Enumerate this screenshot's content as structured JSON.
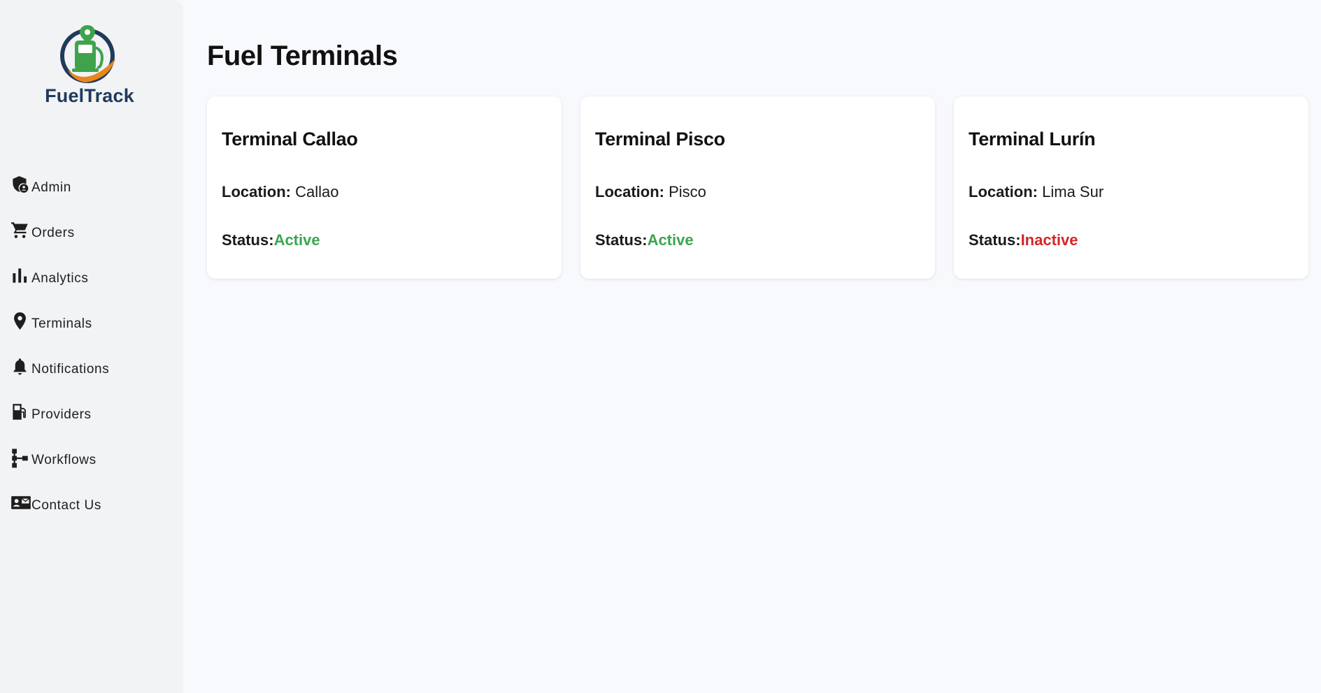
{
  "app": {
    "brand_name": "FuelTrack",
    "accent_colors": {
      "brand_navy": "#1f3a5c",
      "brand_green": "#3fa34d",
      "brand_orange": "#e8871e",
      "active": "#3aa651",
      "inactive": "#d62626"
    }
  },
  "sidebar": {
    "items": [
      {
        "label": "Admin",
        "icon": "admin-shield-icon"
      },
      {
        "label": "Orders",
        "icon": "shopping-cart-icon"
      },
      {
        "label": "Analytics",
        "icon": "bar-chart-icon"
      },
      {
        "label": "Terminals",
        "icon": "map-pin-icon"
      },
      {
        "label": "Notifications",
        "icon": "bell-icon"
      },
      {
        "label": "Providers",
        "icon": "fuel-pump-icon"
      },
      {
        "label": "Workflows",
        "icon": "workflow-icon"
      },
      {
        "label": "Contact Us",
        "icon": "contact-card-icon"
      }
    ]
  },
  "main": {
    "title": "Fuel Terminals",
    "location_label": "Location:",
    "status_label": "Status:",
    "terminals": [
      {
        "name": "Terminal Callao",
        "location": "Callao",
        "status": "Active"
      },
      {
        "name": "Terminal Pisco",
        "location": "Pisco",
        "status": "Active"
      },
      {
        "name": "Terminal Lurín",
        "location": "Lima Sur",
        "status": "Inactive"
      }
    ]
  }
}
